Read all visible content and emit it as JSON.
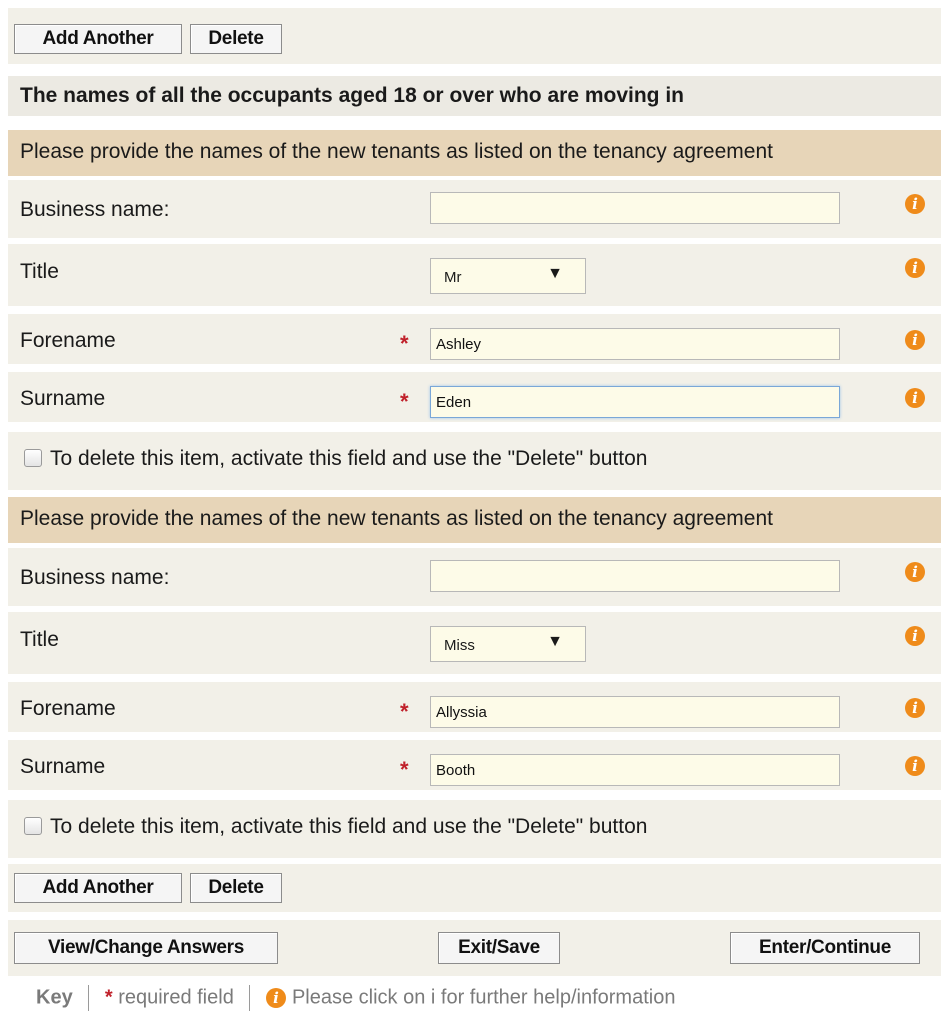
{
  "toolbar": {
    "add_another": "Add Another",
    "delete": "Delete"
  },
  "section": {
    "heading": "The names of all the occupants aged 18 or over who are moving in"
  },
  "tenants": [
    {
      "subheading": "Please provide the names of the new tenants as listed on the tenancy agreement",
      "business_name_label": "Business name:",
      "business_name_value": "",
      "title_label": "Title",
      "title_value": "Mr",
      "forename_label": "Forename",
      "forename_value": "Ashley",
      "surname_label": "Surname",
      "surname_value": "Eden",
      "delete_checkbox_label": "To delete this item, activate this field and use the \"Delete\" button",
      "delete_checked": false
    },
    {
      "subheading": "Please provide the names of the new tenants as listed on the tenancy agreement",
      "business_name_label": "Business name:",
      "business_name_value": "",
      "title_label": "Title",
      "title_value": "Miss",
      "forename_label": "Forename",
      "forename_value": "Allyssia",
      "surname_label": "Surname",
      "surname_value": "Booth",
      "delete_checkbox_label": "To delete this item, activate this field and use the \"Delete\" button",
      "delete_checked": false
    }
  ],
  "nav": {
    "view_change": "View/Change Answers",
    "exit_save": "Exit/Save",
    "enter_continue": "Enter/Continue"
  },
  "key": {
    "title": "Key",
    "required_symbol": "*",
    "required_text": "required field",
    "info_symbol": "i",
    "info_text": "Please click on i for further help/information"
  },
  "icons": {
    "info": "info-icon",
    "required": "required-star-icon",
    "dropdown": "dropdown-arrow-icon"
  },
  "colors": {
    "panel": "#f2f0e8",
    "subheading": "#e7d5b8",
    "info_icon": "#ef8b1a",
    "required_star": "#c0202a",
    "input_bg": "#fdfbe8"
  }
}
